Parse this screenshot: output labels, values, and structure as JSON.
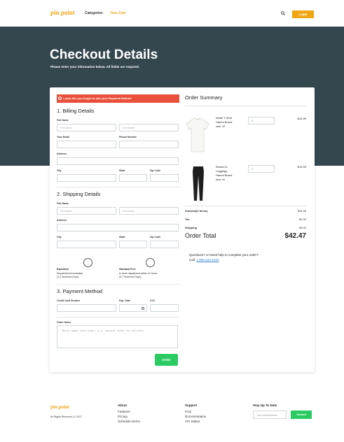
{
  "nav": {
    "logo": "pin point",
    "categories": "Categories",
    "cart": "Your Cart",
    "login": "Login",
    "search_icon": "search-icon"
  },
  "hero": {
    "title": "Checkout Details",
    "subtitle": "Please enter your information below. All fields are required."
  },
  "alert": {
    "icon": "!",
    "text": "Looks like you forgot to add your Payment Method!"
  },
  "billing": {
    "title": "1. Billing Details",
    "full_name_label": "Full Name",
    "first_name_placeholder": "First Name",
    "last_name_placeholder": "Last Name",
    "email_label": "Your Email",
    "phone_label": "Phone Number",
    "address_label": "Address",
    "city_label": "City",
    "state_label": "State",
    "zip_label": "Zip Code"
  },
  "shipping": {
    "title": "2. Shipping Details",
    "full_name_label": "Full Name",
    "first_name_placeholder": "First Name",
    "last_name_placeholder": "Last Name",
    "address_label": "Address",
    "city_label": "City",
    "state_label": "State",
    "zip_label": "Zip Code",
    "options": [
      {
        "label": "Expedited",
        "line1": "Dispatched immediately",
        "line2": "(1-2 Business Days)"
      },
      {
        "label": "Standard Free",
        "line1": "In stock dispatched within 24 hours",
        "line2": "(3-7 Business Days)"
      }
    ]
  },
  "payment": {
    "title": "3. Payment Method",
    "card_label": "Credit Card Number",
    "exp_label": "Exp. Date",
    "cvv_label": "CVV",
    "notes_label": "Order Notes",
    "notes_placeholder": "Notes about your order, e.g. special notes for delivery",
    "order_button": "Order"
  },
  "summary": {
    "title": "Order Summary",
    "items": [
      {
        "name_lines": [
          "White T-Shirt",
          "Hanes Brand",
          "size: M"
        ],
        "qty": "1",
        "price": "$14.99"
      },
      {
        "name_lines": [
          "Women's",
          "Leggings",
          "Hanes Brand",
          "size: M"
        ],
        "qty": "1",
        "price": "$19.99"
      }
    ],
    "subtotal_label": "Subtotal(2 Items)",
    "subtotal_value": "$34.98",
    "tax_label": "Tax",
    "tax_value": "$2.49",
    "shipping_label": "Shipping",
    "shipping_value": "$5.00",
    "total_label": "Order Total",
    "total_value": "$42.47",
    "help_text": "Questions? or Need help to complete your order?",
    "call_label": "Call:",
    "phone": "1-800-123-1234"
  },
  "footer": {
    "logo": "pin point",
    "copyright": "All Rights Reserved | © 2017",
    "about_head": "About",
    "about_links": [
      "Features",
      "Pricing",
      "Schedule Demo"
    ],
    "support_head": "Support",
    "support_links": [
      "FAQ",
      "Documentation",
      "API Status"
    ],
    "stay_head": "Stay Up To Date",
    "email_placeholder": "Your email address",
    "submit": "Submit"
  }
}
